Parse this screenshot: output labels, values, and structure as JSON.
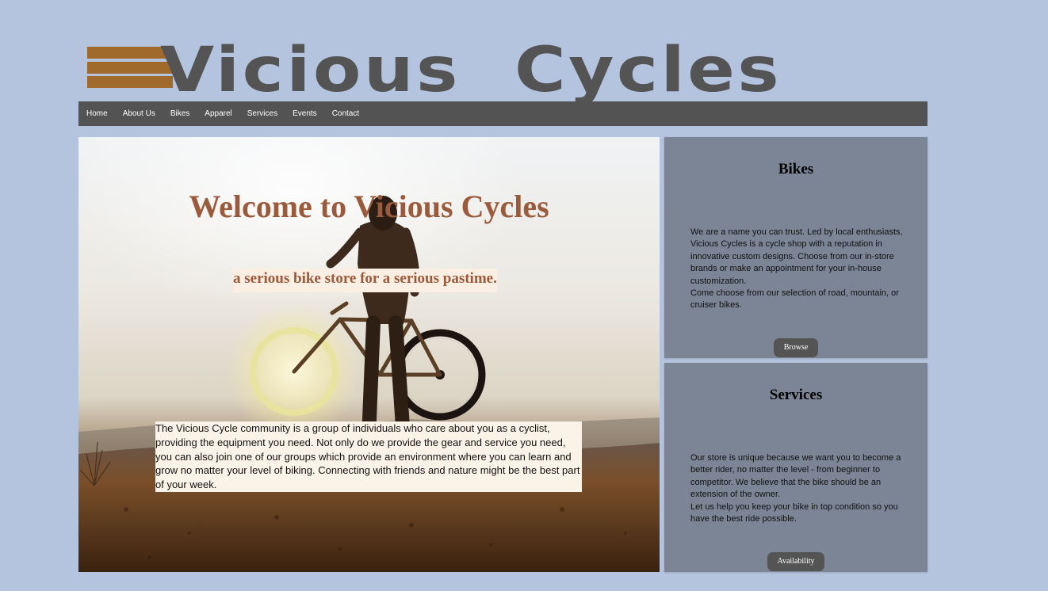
{
  "brand": {
    "name": "Vicious  Cycles",
    "stripe_color": "#a06a2b",
    "text_color": "#545454"
  },
  "nav": {
    "items": [
      "Home",
      "About Us",
      "Bikes",
      "Apparel",
      "Services",
      "Events",
      "Contact"
    ]
  },
  "hero": {
    "title": "Welcome to Vicious Cycles",
    "tagline": "a serious bike store for a serious pastime.",
    "body": "The Vicious Cycle community is a group of individuals who care about you as a cyclist, providing the equipment you need. Not only do we provide the gear and service you need, you can also join one of our groups which provide an environment where you can learn and grow no matter your level of biking. Connecting with friends and nature might be the best part of your week."
  },
  "bikes_panel": {
    "heading": "Bikes",
    "text_1": "We are a name you can trust. Led by local enthusiasts, Vicious Cycles is a cycle shop with a reputation in innovative custom designs. Choose from our in-store brands or make an appointment for your in-house customization.",
    "text_2": "Come choose from our selection of road, mountain, or cruiser bikes.",
    "button": "Browse"
  },
  "services_panel": {
    "heading": "Services",
    "text_1": "Our store is unique because we want you to become a better rider, no matter the level - from beginner to competitor. We believe that the bike should be an extension of the owner.",
    "text_2": "Let us help you keep your bike in top condition so you have the best ride possible.",
    "button": "Availability"
  },
  "colors": {
    "page_background": "#b4c3de",
    "nav_background": "#535353",
    "panel_background": "#7b8596",
    "heading_accent": "#9a5a3b"
  }
}
